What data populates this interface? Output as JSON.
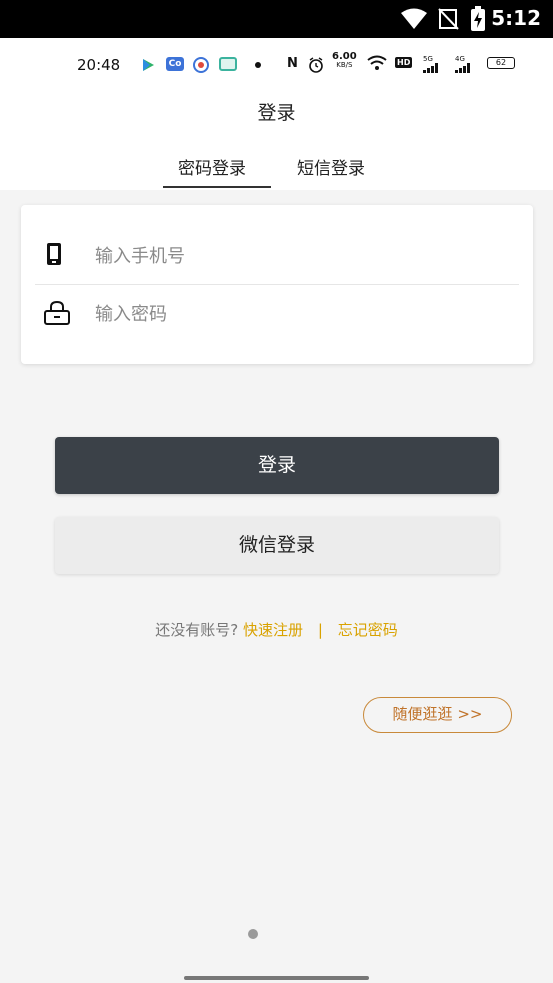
{
  "system_status": {
    "time": "5:12",
    "icons": [
      "wifi-icon",
      "no-signal-icon",
      "battery-charging-icon"
    ]
  },
  "inner_status": {
    "time": "20:48",
    "speed_value": "6.00",
    "speed_unit": "KB/S",
    "hd_label": "HD",
    "net_5g": "5G",
    "net_4g": "4G",
    "battery": "62",
    "nfc_label": "N",
    "app_badge": "Co"
  },
  "header": {
    "title": "登录",
    "tabs": [
      {
        "label": "密码登录",
        "active": true
      },
      {
        "label": "短信登录",
        "active": false
      }
    ]
  },
  "form": {
    "phone": {
      "placeholder": "输入手机号",
      "value": "",
      "icon": "phone-icon"
    },
    "password": {
      "placeholder": "输入密码",
      "value": "",
      "icon": "lock-icon"
    }
  },
  "buttons": {
    "login": "登录",
    "wechat": "微信登录",
    "browse": "随便逛逛 >>"
  },
  "links": {
    "no_account": "还没有账号?",
    "register": "快速注册",
    "separator": "|",
    "forgot": "忘记密码"
  },
  "colors": {
    "primary_button": "#3b4148",
    "accent": "#d9a200",
    "browse_border": "#c8893a"
  }
}
